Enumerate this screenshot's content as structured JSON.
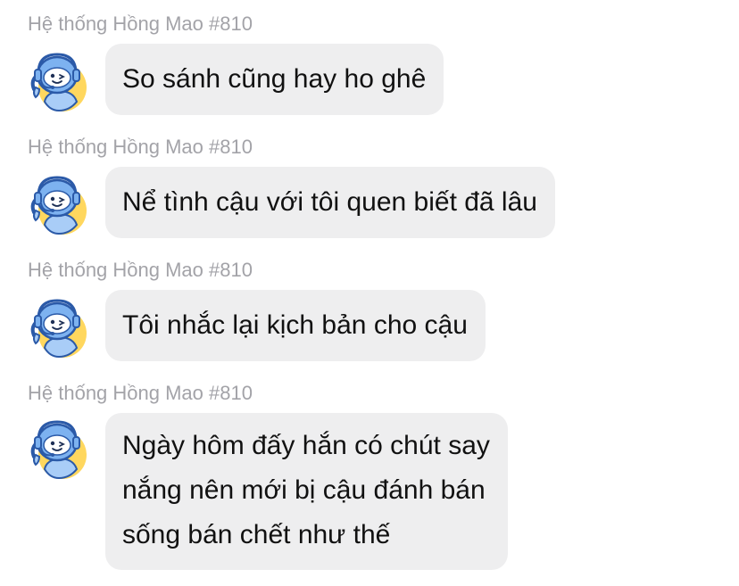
{
  "messages": [
    {
      "sender": "Hệ thống Hồng Mao #810",
      "text": "So sánh cũng hay ho ghê"
    },
    {
      "sender": "Hệ thống Hồng Mao #810",
      "text": "Nể tình cậu với tôi quen biết đã lâu"
    },
    {
      "sender": "Hệ thống Hồng Mao #810",
      "text": "Tôi nhắc lại kịch bản cho cậu"
    },
    {
      "sender": "Hệ thống Hồng Mao #810",
      "lines": [
        "Ngày hôm đấy hắn có chút say",
        "nắng nên mới bị cậu đánh bán",
        "sống bán chết như thế"
      ]
    }
  ],
  "avatar_icon": "robot-mascot-avatar-icon",
  "colors": {
    "bubble": "#eeeeef",
    "sender": "#a3a3a8",
    "text": "#111111",
    "avatar_blue": "#6fa8ee",
    "avatar_yellow": "#ffd75e"
  }
}
